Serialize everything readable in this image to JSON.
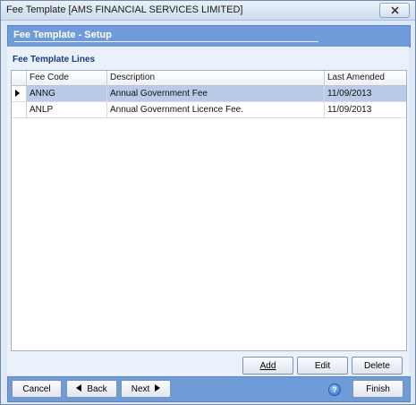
{
  "window": {
    "title": "Fee Template [AMS FINANCIAL SERVICES LIMITED]"
  },
  "header": {
    "title": "Fee Template - Setup"
  },
  "section": {
    "title": "Fee Template Lines"
  },
  "grid": {
    "columns": [
      "Fee Code",
      "Description",
      "Last Amended"
    ],
    "rows": [
      {
        "fee_code": "ANNG",
        "description": "Annual Government Fee",
        "last_amended": "11/09/2013",
        "selected": true
      },
      {
        "fee_code": "ANLP",
        "description": "Annual Government Licence Fee.",
        "last_amended": "11/09/2013",
        "selected": false
      }
    ]
  },
  "actions": {
    "add": "Add",
    "edit": "Edit",
    "delete": "Delete"
  },
  "footer": {
    "cancel": "Cancel",
    "back": "Back",
    "next": "Next",
    "help": "?",
    "finish": "Finish"
  },
  "colors": {
    "header_blue": "#6f9bd8",
    "selection": "#b9cbe6",
    "section_title": "#1e3a7a"
  }
}
